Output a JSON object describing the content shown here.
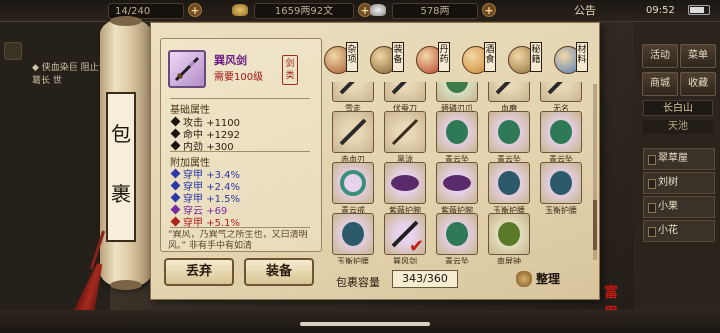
{
  "status_bar": {
    "bag_count": "14/240",
    "copper": "1659两92文",
    "silver": "578两",
    "announcement": "公告",
    "time": "09:52"
  },
  "chat": {
    "text": "◆ 侠血染巨 阻止诸葛长 世"
  },
  "right_menu": {
    "buttons": [
      "活动",
      "菜单",
      "商城",
      "收藏"
    ],
    "region": "长白山",
    "sub_region": "天池",
    "npcs": [
      "翠草屋",
      "刘树",
      "小果",
      "小花"
    ]
  },
  "scroll_title": {
    "chars": [
      "包",
      "裹"
    ]
  },
  "item_detail": {
    "name": "巽风剑",
    "requirement": "需要100级",
    "type_badge": "剑类",
    "base_header": "基础属性",
    "base_stats": [
      {
        "label": "攻击",
        "value": "+1100"
      },
      {
        "label": "命中",
        "value": "+1292"
      },
      {
        "label": "内劲",
        "value": "+300"
      }
    ],
    "extra_header": "附加属性",
    "extra_stats": [
      {
        "label": "穿甲",
        "value": "+3.4%",
        "color": "blue"
      },
      {
        "label": "穿甲",
        "value": "+2.4%",
        "color": "blue"
      },
      {
        "label": "穿甲",
        "value": "+1.5%",
        "color": "blue"
      },
      {
        "label": "穿云",
        "value": "+69",
        "color": "purple"
      },
      {
        "label": "穿甲",
        "value": "+5.1%",
        "color": "red"
      }
    ],
    "description": "“巽风，乃巽气之所生也，又曰清明风。”   非有手中有如清"
  },
  "buttons": {
    "discard": "丢弃",
    "equip": "装备",
    "sort": "整理"
  },
  "categories": [
    {
      "label": "杂项",
      "color": "#a0522d"
    },
    {
      "label": "装备",
      "color": "#7a5a2a"
    },
    {
      "label": "丹药",
      "color": "#b23a26"
    },
    {
      "label": "酒食",
      "color": "#c9822e"
    },
    {
      "label": "秘籍",
      "color": "#8d6a3a"
    },
    {
      "label": "材料",
      "color": "#4a78b8"
    }
  ],
  "items": [
    {
      "name": "雪走",
      "kind": "blade"
    },
    {
      "name": "伏蚕刀",
      "kind": "blade"
    },
    {
      "name": "碧磷刃爪",
      "kind": "claw"
    },
    {
      "name": "血磨",
      "kind": "blade"
    },
    {
      "name": "无名",
      "kind": "blade"
    },
    {
      "name": "赤血刃",
      "kind": "blade"
    },
    {
      "name": "黑泷",
      "kind": "staff"
    },
    {
      "name": "青云坠",
      "kind": "pendant"
    },
    {
      "name": "青云坠",
      "kind": "pendant"
    },
    {
      "name": "青云坠",
      "kind": "pendant"
    },
    {
      "name": "青云戒",
      "kind": "ring"
    },
    {
      "name": "紫薇护腕",
      "kind": "wrist"
    },
    {
      "name": "紫薇护腕",
      "kind": "wrist"
    },
    {
      "name": "玉衡护腰",
      "kind": "belt"
    },
    {
      "name": "玉衡护腰",
      "kind": "belt"
    },
    {
      "name": "玉衡护腰",
      "kind": "belt"
    },
    {
      "name": "巽风剑",
      "kind": "sword"
    },
    {
      "name": "青云坠",
      "kind": "pendant"
    },
    {
      "name": "南屏钟",
      "kind": "bell"
    }
  ],
  "selected_item_index": 16,
  "capacity": {
    "label": "包裹容量",
    "value": "343/360"
  },
  "seal_text": "富甲"
}
